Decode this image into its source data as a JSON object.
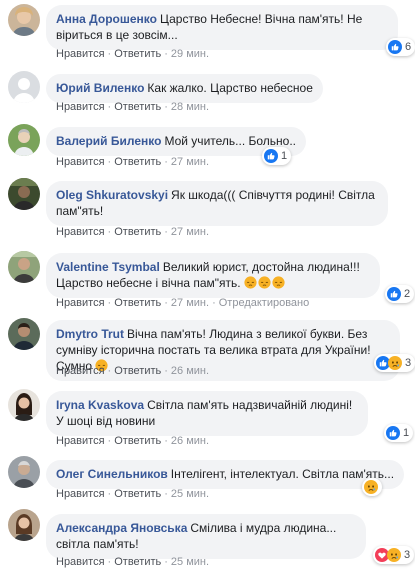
{
  "labels": {
    "like": "Нравится",
    "reply": "Ответить",
    "dot": "·"
  },
  "comments": [
    {
      "author": "Анна Дорошенко",
      "text": "Царство Небесне! Вічна пам'ять! Не віриться в це зовсім...",
      "time": "29 мин.",
      "reactions": {
        "icons": [
          "like-icon"
        ],
        "count": "6"
      },
      "avatar": "photo-woman-light"
    },
    {
      "author": "Юрий Виленко",
      "text": "Как жалко. Царство небесное",
      "time": "28 мин.",
      "reactions": null,
      "avatar": "default-avatar"
    },
    {
      "author": "Валерий Биленко",
      "text": "Мой учитель... Больно..",
      "time": "27 мин.",
      "reactions": {
        "icons": [
          "like-icon"
        ],
        "count": "1"
      },
      "avatar": "photo-man-green"
    },
    {
      "author": "Oleg Shkuratovskyi",
      "text": "Як шкода((( Співчуття родині! Світла пам\"ять!",
      "time": "27 мин.",
      "reactions": null,
      "avatar": "photo-dark-outdoor"
    },
    {
      "author": "Valentine Tsymbal",
      "text": "Великий юрист, достойна людина!!! Царство небесне і вічна пам\"ять.",
      "emojis": [
        "pensive-emoji",
        "pensive-emoji",
        "pensive-emoji"
      ],
      "time": "27 мин.",
      "edited": "Отредактировано",
      "reactions": {
        "icons": [
          "like-icon"
        ],
        "count": "2"
      },
      "avatar": "photo-man-outdoor"
    },
    {
      "author": "Dmytro Trut",
      "text": "Вічна пам'ять! Людина з великої букви. Без сумніву історична постать та велика втрата для України! Сумно",
      "emojis": [
        "pensive-emoji"
      ],
      "time": "26 мин.",
      "reactions": {
        "icons": [
          "like-icon",
          "sad-icon"
        ],
        "count": "3"
      },
      "avatar": "photo-man-dark"
    },
    {
      "author": "Iryna Kvaskova",
      "text": "Світла пам'ять надзвичайній людині! У шоці від новини",
      "time": "26 мин.",
      "reactions": {
        "icons": [
          "like-icon"
        ],
        "count": "1"
      },
      "avatar": "photo-woman-dark-hair"
    },
    {
      "author": "Олег Синельников",
      "text": "Інтелігент, інтелектуал. Світла пам'ять...",
      "time": "25 мин.",
      "reactions": {
        "icons": [
          "sad-icon"
        ],
        "count": ""
      },
      "avatar": "photo-man-grey"
    },
    {
      "author": "Александра Яновська",
      "text": "Смілива і мудра людина... світла пам'ять!",
      "time": "25 мин.",
      "reactions": {
        "icons": [
          "love-icon",
          "sad-icon"
        ],
        "count": "3"
      },
      "avatar": "photo-woman-brown"
    }
  ],
  "colors": {
    "author": "#385898",
    "bubble": "#f2f3f5",
    "meta": "#90949c",
    "like_blue": "#1877f2",
    "love_red": "#f33e58",
    "sad_yellow": "#f7b125"
  }
}
